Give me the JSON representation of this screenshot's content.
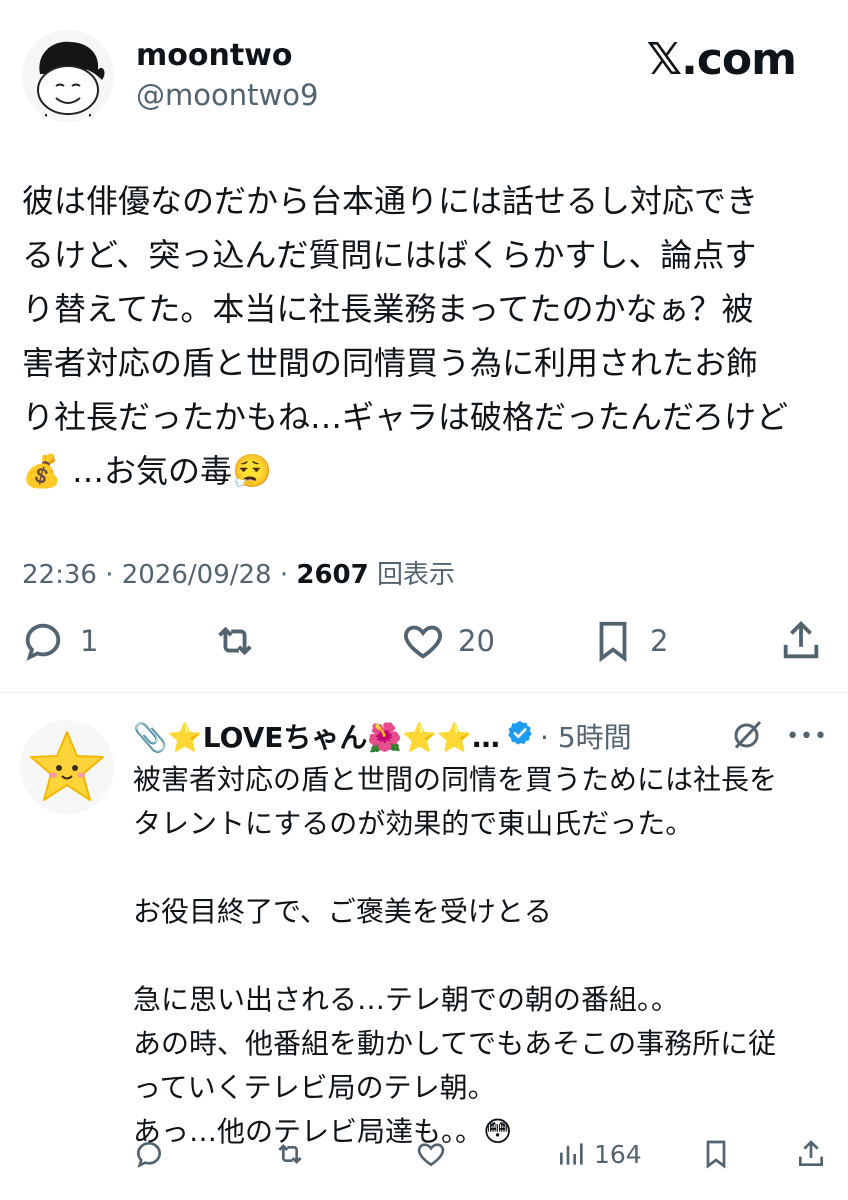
{
  "header": {
    "display_name": "moontwo",
    "handle": "@moontwo9",
    "brand": "𝕏.com"
  },
  "tweet": {
    "text": "彼は俳優なのだから台本通りには話せるし対応でき\nるけど、突っ込んだ質問にはばくらかすし、論点す\nり替えてた。本当に社長業務まってたのかなぁ？被\n害者対応の盾と世間の同情買う為に利用されたお飾\nり社長だったかもね…ギャラは破格だったんだろけど\n💰 …お気の毒😮‍💨",
    "time": "22:36 · 2026/09/28 · ",
    "views_count": "2607",
    "views_label": " 回表示"
  },
  "actions": {
    "replies": "1",
    "retweets": "",
    "likes": "20",
    "bookmarks": "2"
  },
  "reply": {
    "display_name": "📎⭐LOVEちゃん🌺⭐⭐…",
    "time": "· 5時間",
    "text": "被害者対応の盾と世間の同情を買うためには社長を\nタレントにするのが効果的で東山氏だった。\n\nお役目終了で、ご褒美を受けとる\n\n急に思い出される…テレ朝での朝の番組。。\nあの時、他番組を動かしてでもあそこの事務所に従\nっていくテレビ局のテレ朝。\nあっ…他のテレビ局達も。。😳",
    "views": "164",
    "more": "•••"
  },
  "colors": {
    "text": "#0f1419",
    "secondary": "#536471",
    "verified": "#1d9bf0",
    "divider": "#eff3f4"
  }
}
